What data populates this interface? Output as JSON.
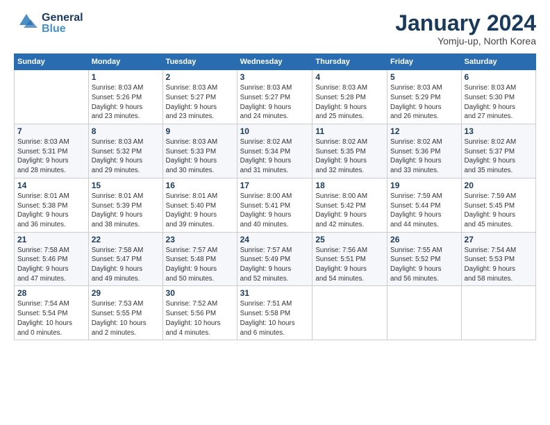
{
  "header": {
    "logo_general": "General",
    "logo_blue": "Blue",
    "title": "January 2024",
    "subtitle": "Yomju-up, North Korea"
  },
  "weekdays": [
    "Sunday",
    "Monday",
    "Tuesday",
    "Wednesday",
    "Thursday",
    "Friday",
    "Saturday"
  ],
  "weeks": [
    [
      {
        "day": "",
        "info": ""
      },
      {
        "day": "1",
        "info": "Sunrise: 8:03 AM\nSunset: 5:26 PM\nDaylight: 9 hours\nand 23 minutes."
      },
      {
        "day": "2",
        "info": "Sunrise: 8:03 AM\nSunset: 5:27 PM\nDaylight: 9 hours\nand 23 minutes."
      },
      {
        "day": "3",
        "info": "Sunrise: 8:03 AM\nSunset: 5:27 PM\nDaylight: 9 hours\nand 24 minutes."
      },
      {
        "day": "4",
        "info": "Sunrise: 8:03 AM\nSunset: 5:28 PM\nDaylight: 9 hours\nand 25 minutes."
      },
      {
        "day": "5",
        "info": "Sunrise: 8:03 AM\nSunset: 5:29 PM\nDaylight: 9 hours\nand 26 minutes."
      },
      {
        "day": "6",
        "info": "Sunrise: 8:03 AM\nSunset: 5:30 PM\nDaylight: 9 hours\nand 27 minutes."
      }
    ],
    [
      {
        "day": "7",
        "info": "Sunrise: 8:03 AM\nSunset: 5:31 PM\nDaylight: 9 hours\nand 28 minutes."
      },
      {
        "day": "8",
        "info": "Sunrise: 8:03 AM\nSunset: 5:32 PM\nDaylight: 9 hours\nand 29 minutes."
      },
      {
        "day": "9",
        "info": "Sunrise: 8:03 AM\nSunset: 5:33 PM\nDaylight: 9 hours\nand 30 minutes."
      },
      {
        "day": "10",
        "info": "Sunrise: 8:02 AM\nSunset: 5:34 PM\nDaylight: 9 hours\nand 31 minutes."
      },
      {
        "day": "11",
        "info": "Sunrise: 8:02 AM\nSunset: 5:35 PM\nDaylight: 9 hours\nand 32 minutes."
      },
      {
        "day": "12",
        "info": "Sunrise: 8:02 AM\nSunset: 5:36 PM\nDaylight: 9 hours\nand 33 minutes."
      },
      {
        "day": "13",
        "info": "Sunrise: 8:02 AM\nSunset: 5:37 PM\nDaylight: 9 hours\nand 35 minutes."
      }
    ],
    [
      {
        "day": "14",
        "info": "Sunrise: 8:01 AM\nSunset: 5:38 PM\nDaylight: 9 hours\nand 36 minutes."
      },
      {
        "day": "15",
        "info": "Sunrise: 8:01 AM\nSunset: 5:39 PM\nDaylight: 9 hours\nand 38 minutes."
      },
      {
        "day": "16",
        "info": "Sunrise: 8:01 AM\nSunset: 5:40 PM\nDaylight: 9 hours\nand 39 minutes."
      },
      {
        "day": "17",
        "info": "Sunrise: 8:00 AM\nSunset: 5:41 PM\nDaylight: 9 hours\nand 40 minutes."
      },
      {
        "day": "18",
        "info": "Sunrise: 8:00 AM\nSunset: 5:42 PM\nDaylight: 9 hours\nand 42 minutes."
      },
      {
        "day": "19",
        "info": "Sunrise: 7:59 AM\nSunset: 5:44 PM\nDaylight: 9 hours\nand 44 minutes."
      },
      {
        "day": "20",
        "info": "Sunrise: 7:59 AM\nSunset: 5:45 PM\nDaylight: 9 hours\nand 45 minutes."
      }
    ],
    [
      {
        "day": "21",
        "info": "Sunrise: 7:58 AM\nSunset: 5:46 PM\nDaylight: 9 hours\nand 47 minutes."
      },
      {
        "day": "22",
        "info": "Sunrise: 7:58 AM\nSunset: 5:47 PM\nDaylight: 9 hours\nand 49 minutes."
      },
      {
        "day": "23",
        "info": "Sunrise: 7:57 AM\nSunset: 5:48 PM\nDaylight: 9 hours\nand 50 minutes."
      },
      {
        "day": "24",
        "info": "Sunrise: 7:57 AM\nSunset: 5:49 PM\nDaylight: 9 hours\nand 52 minutes."
      },
      {
        "day": "25",
        "info": "Sunrise: 7:56 AM\nSunset: 5:51 PM\nDaylight: 9 hours\nand 54 minutes."
      },
      {
        "day": "26",
        "info": "Sunrise: 7:55 AM\nSunset: 5:52 PM\nDaylight: 9 hours\nand 56 minutes."
      },
      {
        "day": "27",
        "info": "Sunrise: 7:54 AM\nSunset: 5:53 PM\nDaylight: 9 hours\nand 58 minutes."
      }
    ],
    [
      {
        "day": "28",
        "info": "Sunrise: 7:54 AM\nSunset: 5:54 PM\nDaylight: 10 hours\nand 0 minutes."
      },
      {
        "day": "29",
        "info": "Sunrise: 7:53 AM\nSunset: 5:55 PM\nDaylight: 10 hours\nand 2 minutes."
      },
      {
        "day": "30",
        "info": "Sunrise: 7:52 AM\nSunset: 5:56 PM\nDaylight: 10 hours\nand 4 minutes."
      },
      {
        "day": "31",
        "info": "Sunrise: 7:51 AM\nSunset: 5:58 PM\nDaylight: 10 hours\nand 6 minutes."
      },
      {
        "day": "",
        "info": ""
      },
      {
        "day": "",
        "info": ""
      },
      {
        "day": "",
        "info": ""
      }
    ]
  ]
}
